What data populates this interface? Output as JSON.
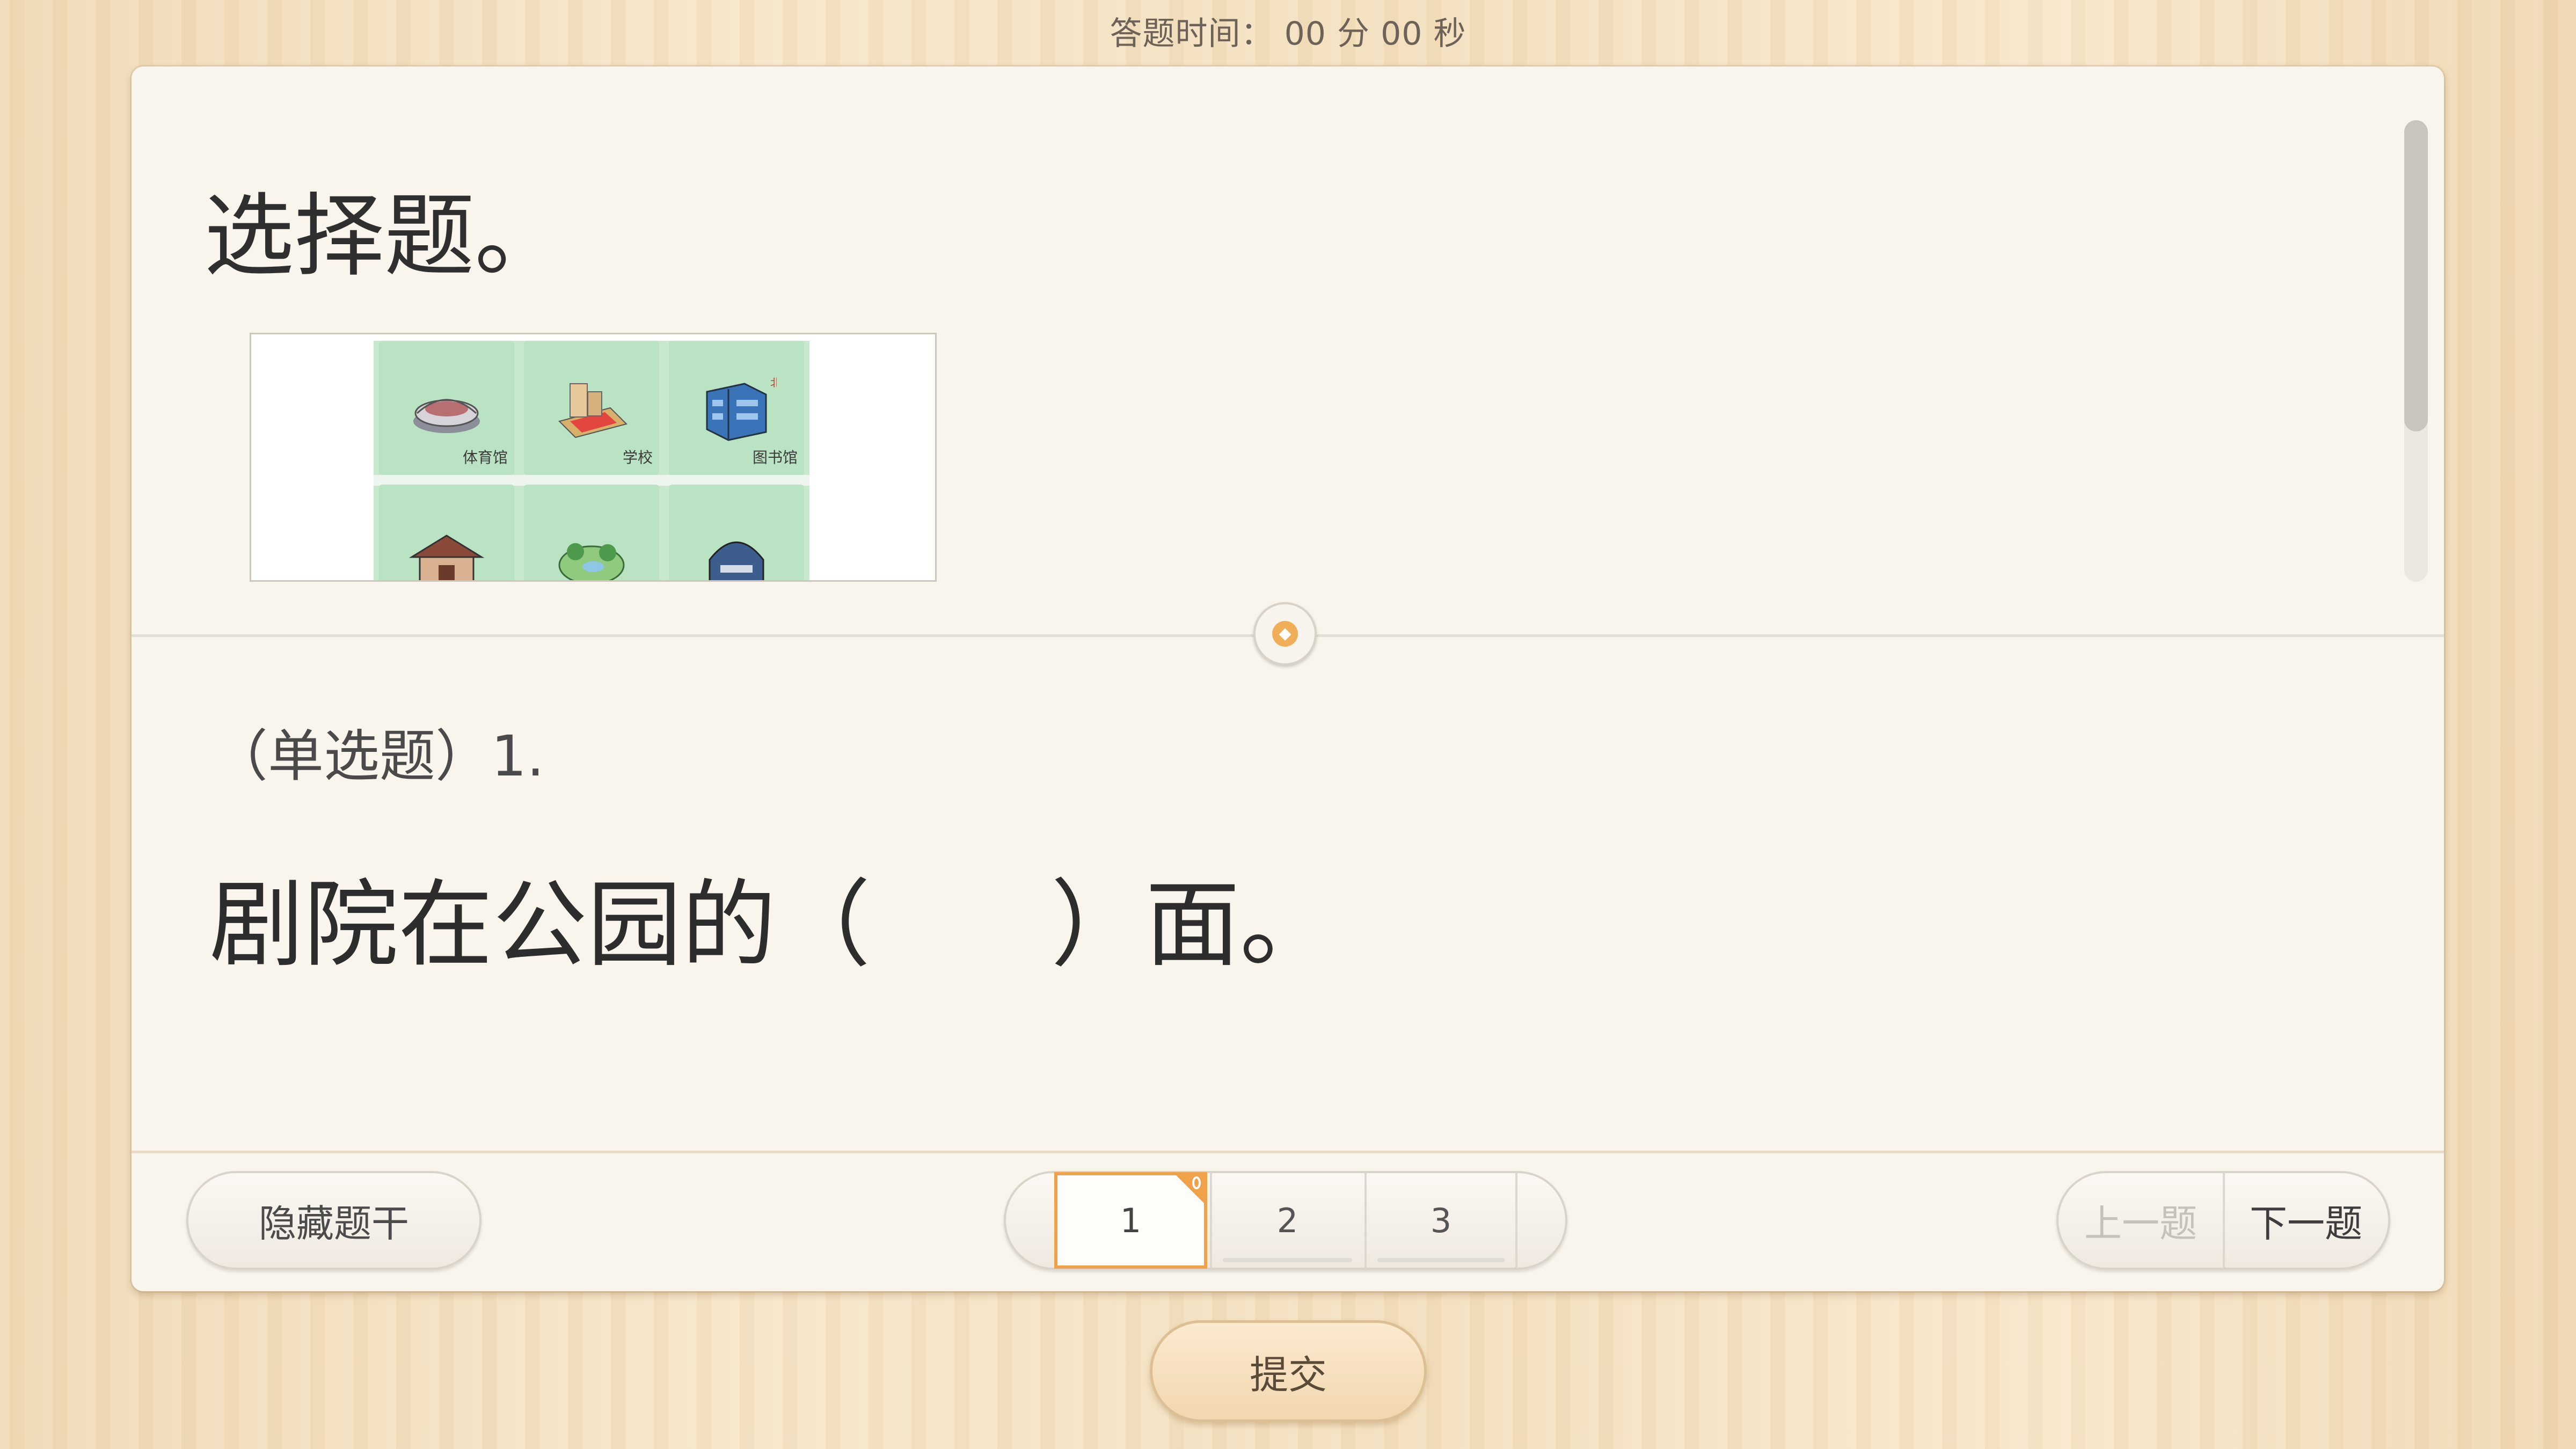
{
  "header": {
    "timer": "答题时间：  00 分 00 秒"
  },
  "stem": {
    "title": "选择题。",
    "figure": {
      "tiles": [
        {
          "icon": "stadium-icon",
          "label": "体育馆"
        },
        {
          "icon": "school-icon",
          "label": "学校"
        },
        {
          "icon": "library-icon",
          "label": "图书馆"
        },
        {
          "icon": "theater-icon",
          "label": ""
        },
        {
          "icon": "park-icon",
          "label": ""
        },
        {
          "icon": "dome-building-icon",
          "label": ""
        }
      ],
      "compass_mark": "北"
    }
  },
  "question": {
    "type": "（单选题）1.",
    "text": "剧院在公园的（      ）面。"
  },
  "footer": {
    "hide_stem_label": "隐藏题干",
    "pages": [
      "1",
      "2",
      "3"
    ],
    "current_page": "1",
    "prev_label": "上一题",
    "next_label": "下一题"
  },
  "submit_label": "提交",
  "colors": {
    "accent": "#f0a24b",
    "card_bg": "#faf5ec",
    "map_green": "#b9e3c2"
  }
}
